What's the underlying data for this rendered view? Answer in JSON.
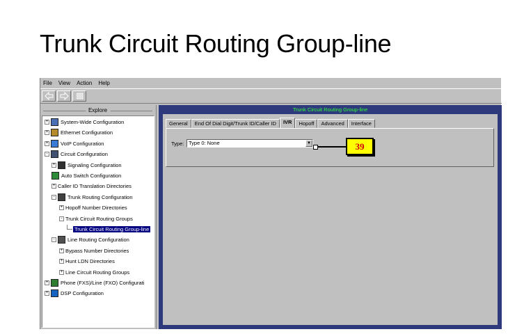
{
  "slide_title": "Trunk Circuit Routing Group-line",
  "menu": [
    "File",
    "View",
    "Action",
    "Help"
  ],
  "explore": {
    "header": "Explore",
    "tree": [
      {
        "label": "System-Wide Configuration",
        "level": 0,
        "expander": "+",
        "icon": "system-icon"
      },
      {
        "label": "Ethernet Configuration",
        "level": 0,
        "expander": "+",
        "icon": "ethernet-icon"
      },
      {
        "label": "VoIP Configuration",
        "level": 0,
        "expander": "+",
        "icon": "voip-icon"
      },
      {
        "label": "Circuit Configuration",
        "level": 0,
        "expander": "-",
        "icon": "circuit-icon"
      },
      {
        "label": "Signaling Configuration",
        "level": 1,
        "expander": "+",
        "icon": "signaling-icon"
      },
      {
        "label": "Auto Switch Configuration",
        "level": 1,
        "expander": "",
        "icon": "auto-switch-icon"
      },
      {
        "label": "Caller ID Translation Directories",
        "level": 1,
        "expander": "+",
        "icon": ""
      },
      {
        "label": "Trunk Routing Configuration",
        "level": 1,
        "expander": "-",
        "icon": "trunk-routing-icon"
      },
      {
        "label": "Hopoff Number Directories",
        "level": 2,
        "expander": "+",
        "icon": ""
      },
      {
        "label": "Trunk Circuit Routing Groups",
        "level": 2,
        "expander": "-",
        "icon": ""
      },
      {
        "label": "Trunk Circuit Routing Group-line",
        "level": 3,
        "expander": "",
        "icon": "",
        "selected": true
      },
      {
        "label": "Line Routing Configuration",
        "level": 1,
        "expander": "-",
        "icon": "line-routing-icon"
      },
      {
        "label": "Bypass Number Directories",
        "level": 2,
        "expander": "+",
        "icon": ""
      },
      {
        "label": "Hunt LDN Directories",
        "level": 2,
        "expander": "+",
        "icon": ""
      },
      {
        "label": "Line Circuit Routing Groups",
        "level": 2,
        "expander": "+",
        "icon": ""
      },
      {
        "label": "Phone (FXS)/Line (FXO) Configurati",
        "level": 0,
        "expander": "+",
        "icon": "phone-icon"
      },
      {
        "label": "DSP Configuration",
        "level": 0,
        "expander": "+",
        "icon": "dsp-icon"
      }
    ]
  },
  "detail": {
    "title": "Trunk Circuit Routing Group-line",
    "tabs": [
      "General",
      "End Of Dial Digit/Trunk ID/Caller ID",
      "IVR",
      "Hopoff",
      "Advanced",
      "Interface"
    ],
    "active_tab": "IVR",
    "type_label": "Type:",
    "type_value": "Type 0: None"
  },
  "callout": "39",
  "colors": {
    "detail_bg": "#2e3a7c",
    "detail_title": "#33ff33",
    "callout_bg": "#ffff00",
    "callout_text": "#d40000",
    "selection": "#000080"
  }
}
